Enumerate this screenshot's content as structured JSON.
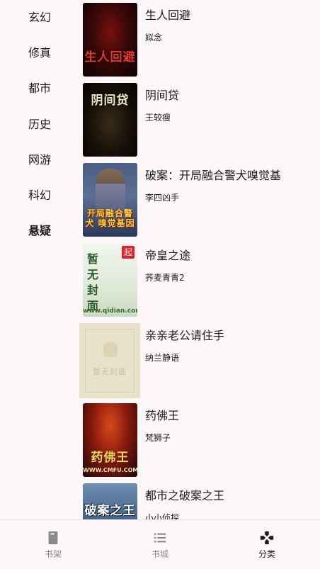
{
  "sidebar": {
    "categories": [
      {
        "label": "玄幻",
        "selected": false
      },
      {
        "label": "修真",
        "selected": false
      },
      {
        "label": "都市",
        "selected": false
      },
      {
        "label": "历史",
        "selected": false
      },
      {
        "label": "网游",
        "selected": false
      },
      {
        "label": "科幻",
        "selected": false
      },
      {
        "label": "悬疑",
        "selected": true
      }
    ]
  },
  "books": [
    {
      "title": "生人回避",
      "author": "姒念",
      "cover_text": "生人回避"
    },
    {
      "title": "阴间贷",
      "author": "王较瘦",
      "cover_text": "阴间贷"
    },
    {
      "title": "破案：开局融合警犬嗅觉基",
      "author": "李四凶手",
      "cover_text": "开局融合警犬 嗅觉基因"
    },
    {
      "title": "帝皇之途",
      "author": "荞麦青青2",
      "cover_text": "暂无封面",
      "cover_badge": "起",
      "cover_site": "www.qidian.com"
    },
    {
      "title": "亲亲老公请住手",
      "author": "纳兰静语",
      "cover_text": "暂无封面"
    },
    {
      "title": "药佛王",
      "author": "梵狮子",
      "cover_text": "药佛王",
      "cover_site": "WWW.CMFU.COM"
    },
    {
      "title": "都市之破案之王",
      "author": "小小侦探",
      "cover_text": "破案之王"
    }
  ],
  "bottom_nav": {
    "items": [
      {
        "label": "书架",
        "icon": "book-icon",
        "active": false
      },
      {
        "label": "书城",
        "icon": "list-icon",
        "active": false
      },
      {
        "label": "分类",
        "icon": "category-icon",
        "active": true
      }
    ]
  },
  "colors": {
    "background": "#fdf7fa",
    "text": "#1c1b1f",
    "nav_inactive": "#8a8a8a"
  }
}
